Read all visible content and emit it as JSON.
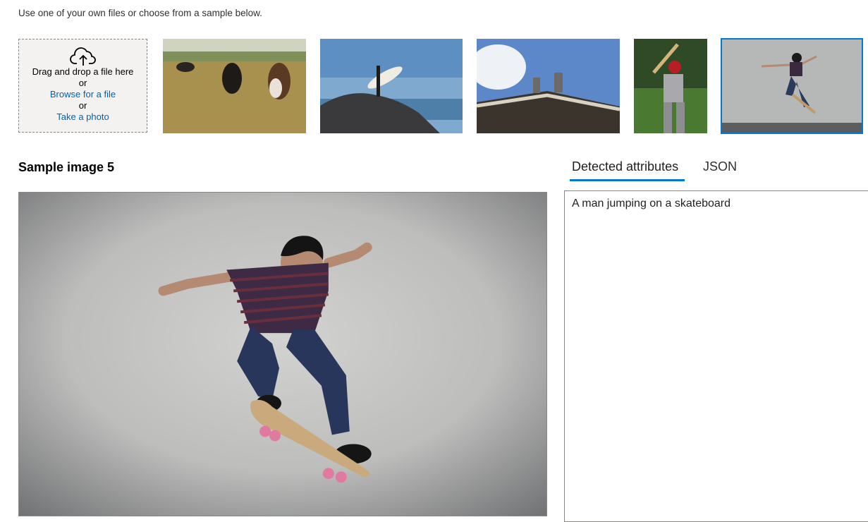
{
  "intro": "Use one of your own files or choose from a sample below.",
  "upload": {
    "icon": "cloud-upload-icon",
    "drag_text": "Drag and drop a file here",
    "or_1": "or",
    "browse": "Browse for a file",
    "or_2": "or",
    "photo": "Take a photo"
  },
  "samples": [
    {
      "subject": "cows grazing"
    },
    {
      "subject": "surfer on rock"
    },
    {
      "subject": "building statues"
    },
    {
      "subject": "baseball batter"
    },
    {
      "subject": "skateboarder",
      "selected": true
    }
  ],
  "sample_title": "Sample image 5",
  "tabs": {
    "detected": "Detected attributes",
    "json": "JSON",
    "active": "detected"
  },
  "result": {
    "caption": "A man jumping on a skateboard"
  },
  "colors": {
    "accent": "#0078d4",
    "link": "#0062ad",
    "upload_bg": "#f3f2f1"
  }
}
